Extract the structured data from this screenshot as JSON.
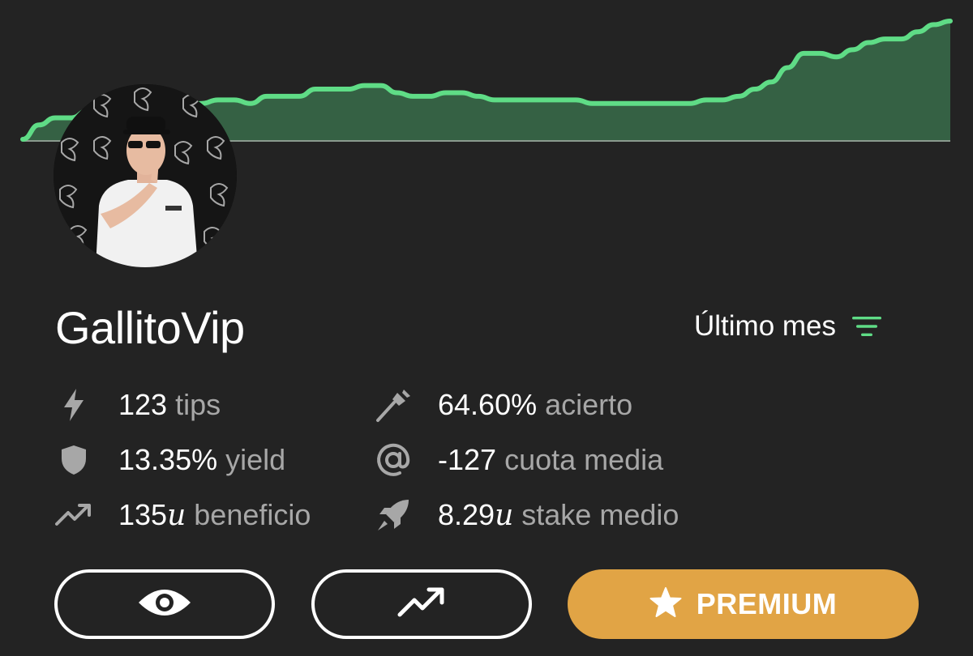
{
  "colors": {
    "background": "#232323",
    "chart_line": "#5fdc86",
    "chart_fill": "#356144",
    "baseline": "#8a9a8e",
    "label_gray": "#a7a7a7",
    "premium": "#e1a445",
    "accent_green": "#5fdc86"
  },
  "profile": {
    "username": "GallitoVip",
    "avatar_icon": "profile-photo"
  },
  "period": {
    "label": "Último mes",
    "icon": "filter-icon"
  },
  "stats": [
    {
      "icon": "bolt-icon",
      "value": "123",
      "label": "tips"
    },
    {
      "icon": "dart-icon",
      "value": "64.60%",
      "label": "acierto"
    },
    {
      "icon": "shield-icon",
      "value": "13.35%",
      "label": "yield"
    },
    {
      "icon": "at-icon",
      "value": "-127",
      "label": "cuota media"
    },
    {
      "icon": "trend-up-icon",
      "value": "135",
      "unit": "u",
      "label": "beneficio"
    },
    {
      "icon": "rocket-icon",
      "value": "8.29",
      "unit": "u",
      "label": "stake medio"
    }
  ],
  "buttons": {
    "view_icon": "eye-icon",
    "stats_icon": "trend-up-icon",
    "premium_label": "PREMIUM",
    "premium_icon": "star-icon"
  },
  "chart_data": {
    "type": "area",
    "values": [
      0,
      4,
      6,
      6,
      8,
      7,
      7,
      5,
      6,
      7,
      9,
      10,
      11,
      11,
      10,
      12,
      12,
      12,
      14,
      14,
      14,
      15,
      15,
      13,
      12,
      12,
      13,
      13,
      12,
      11,
      11,
      11,
      11,
      11,
      11,
      10,
      10,
      10,
      10,
      10,
      10,
      10,
      11,
      11,
      12,
      14,
      16,
      20,
      24,
      24,
      23,
      25,
      27,
      28,
      28,
      30,
      32,
      33
    ],
    "title": "",
    "xlabel": "",
    "ylabel": "",
    "grid": false
  }
}
